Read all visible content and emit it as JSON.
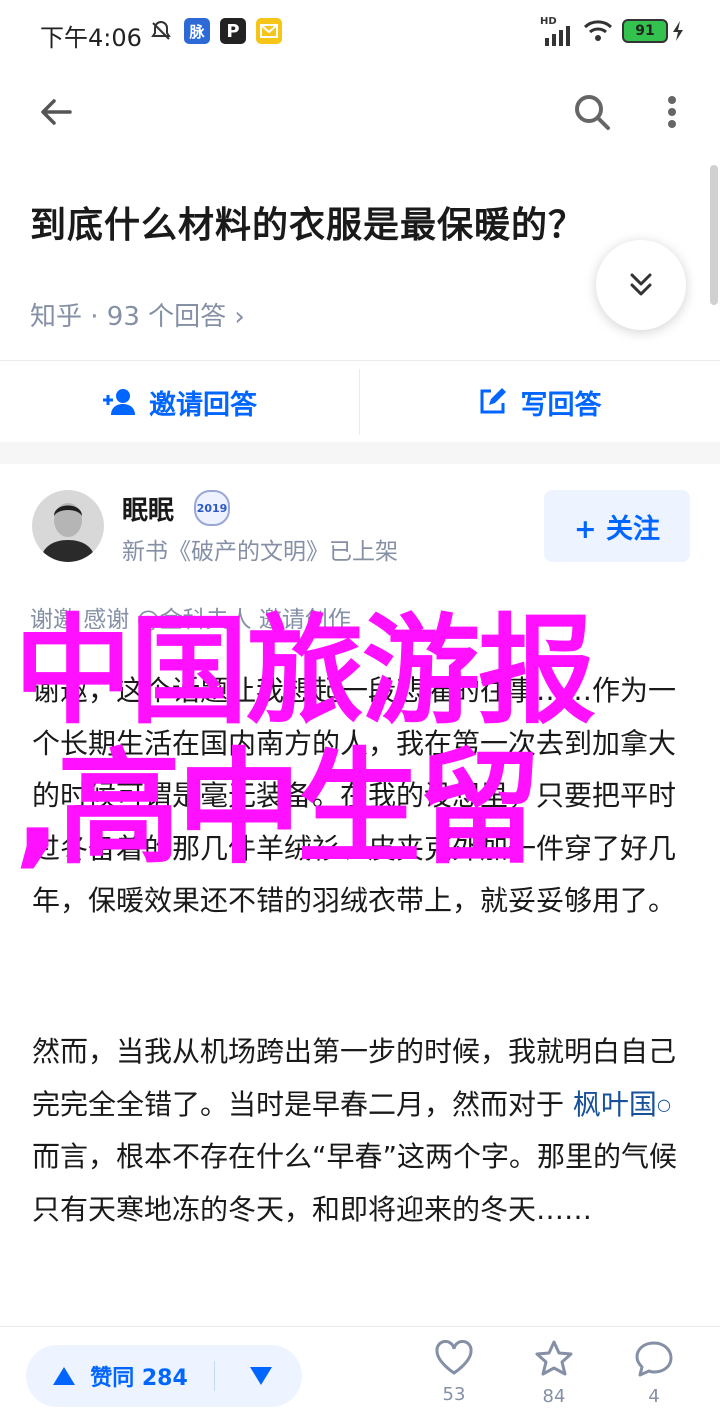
{
  "status_bar": {
    "time": "下午4:06",
    "battery": "91",
    "icons": [
      "mute-icon",
      "mai-badge",
      "p-badge",
      "mail-badge",
      "hd-signal-icon",
      "wifi-icon",
      "battery-icon",
      "charging-icon"
    ],
    "badge_mai": "脉",
    "badge_p": "P",
    "hd_label": "HD"
  },
  "toolbar": {
    "icons": [
      "back-arrow-icon",
      "search-icon",
      "more-vertical-icon"
    ]
  },
  "question": {
    "title": "到底什么材料的衣服是最保暖的？",
    "meta": "知乎 · 93 个回答 ›"
  },
  "actions": {
    "invite_label": "邀请回答",
    "write_label": "写回答"
  },
  "author": {
    "name": "眠眠",
    "badge": "2019",
    "subtitle": "新书《破产的文明》已上架",
    "follow_label": "+ 关注"
  },
  "invite_strip": {
    "text": "谢邀  感谢 @金科夫人  邀请创作"
  },
  "answer": {
    "p1": "谢邀，这个话题让我想起一段悲催的往事……作为一个长期生活在国内南方的人，我在第一次去到加拿大的时候可谓是毫无装备。在我的设想里，只要把平时过冬备着的那几件羊绒衫、皮夹克外加一件穿了好几年，保暖效果还不错的羽绒衣带上，就妥妥够用了。",
    "p2_before": "然而，当我从机场跨出第一步的时候，我就明白自己完完全全错了。当时是早春二月，然而对于",
    "p2_link": "枫叶国",
    "p2_after": "而言，根本不存在什么“早春”这两个字。那里的气候只有天寒地冻的冬天，和即将迎来的冬天……"
  },
  "watermark": {
    "line1": "中国旅游报",
    "line2": ",高中生留"
  },
  "bottom": {
    "upvote_label": "赞同 284",
    "thanks_count": "53",
    "star_count": "84",
    "comment_count": "4"
  },
  "colors": {
    "accent": "#0066ff",
    "watermark": "#ff10ff",
    "meta_gray": "#8590a6",
    "link": "#175199"
  }
}
